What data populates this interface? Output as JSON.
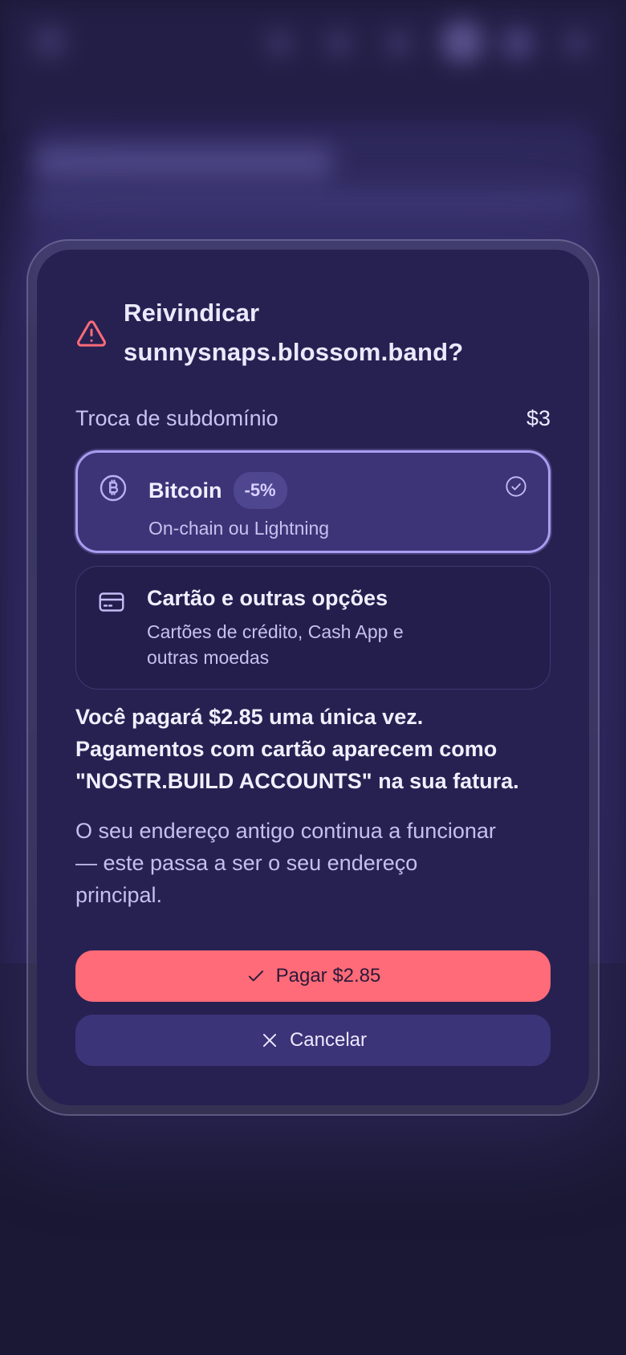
{
  "dialog": {
    "title_line1": "Reivindicar",
    "title_line2": "sunnysnaps.blossom.band?",
    "price_label": "Troca de subdomínio",
    "price_value": "$3",
    "options": [
      {
        "title": "Bitcoin",
        "badge": "-5%",
        "subtitle": "On-chain ou Lightning",
        "icon": "bitcoin-icon",
        "selected": true
      },
      {
        "title": "Cartão e outras opções",
        "subtitle_line1": "Cartões de crédito, Cash App e",
        "subtitle_line2": "outras moedas",
        "icon": "credit-card-icon",
        "selected": false
      }
    ],
    "note_bold_line1": "Você pagará $2.85 uma única vez.",
    "note_bold_line2": "Pagamentos com cartão aparecem como",
    "note_bold_line3": "\"NOSTR.BUILD ACCOUNTS\" na sua fatura.",
    "note_line1": "O seu endereço antigo continua a funcionar",
    "note_line2": "— este passa a ser o seu endereço",
    "note_line3": "principal.",
    "pay_label": "Pagar $2.85",
    "cancel_label": "Cancelar"
  },
  "colors": {
    "accent": "#ff6b78",
    "selected_border": "#a99cf0",
    "modal_bg": "#272152",
    "page_bg": "#1b1835"
  }
}
